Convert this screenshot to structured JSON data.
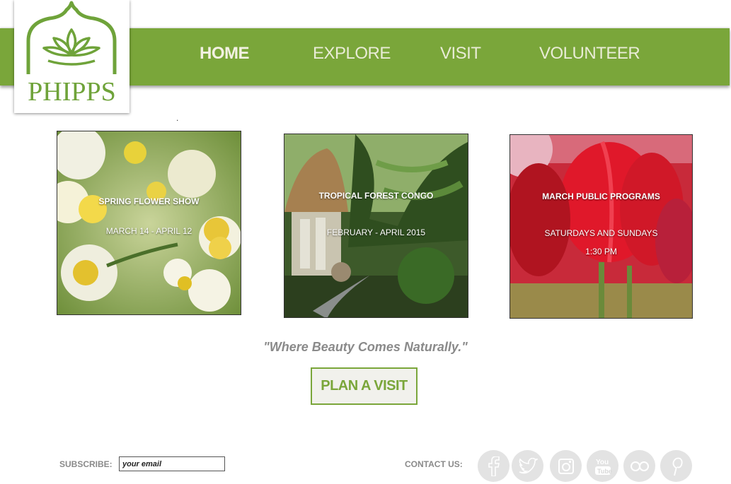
{
  "brand": {
    "logo_text": "PHIPPS",
    "accent_color": "#7aa63a"
  },
  "nav": {
    "items": [
      {
        "label": "HOME",
        "active": true
      },
      {
        "label": "EXPLORE",
        "active": false
      },
      {
        "label": "VISIT",
        "active": false
      },
      {
        "label": "VOLUNTEER",
        "active": false
      }
    ]
  },
  "separator_dot": ".",
  "cards": [
    {
      "title": "SPRING FLOWER SHOW",
      "subtitle": "MARCH 14 - APRIL 12",
      "image": "daffodils"
    },
    {
      "title": "TROPICAL FOREST CONGO",
      "subtitle": "FEBRUARY - APRIL 2015",
      "image": "tropical-conservatory"
    },
    {
      "title": "MARCH PUBLIC PROGRAMS",
      "subtitle": "SATURDAYS AND SUNDAYS",
      "subtitle2": "1:30 PM",
      "image": "red-tulips"
    }
  ],
  "tagline": "\"Where Beauty Comes Naturally.\"",
  "cta": {
    "label": "PLAN A VISIT"
  },
  "footer": {
    "subscribe_label": "SUBSCRIBE:",
    "email_placeholder": "your email",
    "contact_label": "CONTACT US:",
    "social": [
      "facebook-icon",
      "twitter-icon",
      "instagram-icon",
      "youtube-icon",
      "flickr-icon",
      "pinterest-icon"
    ]
  }
}
